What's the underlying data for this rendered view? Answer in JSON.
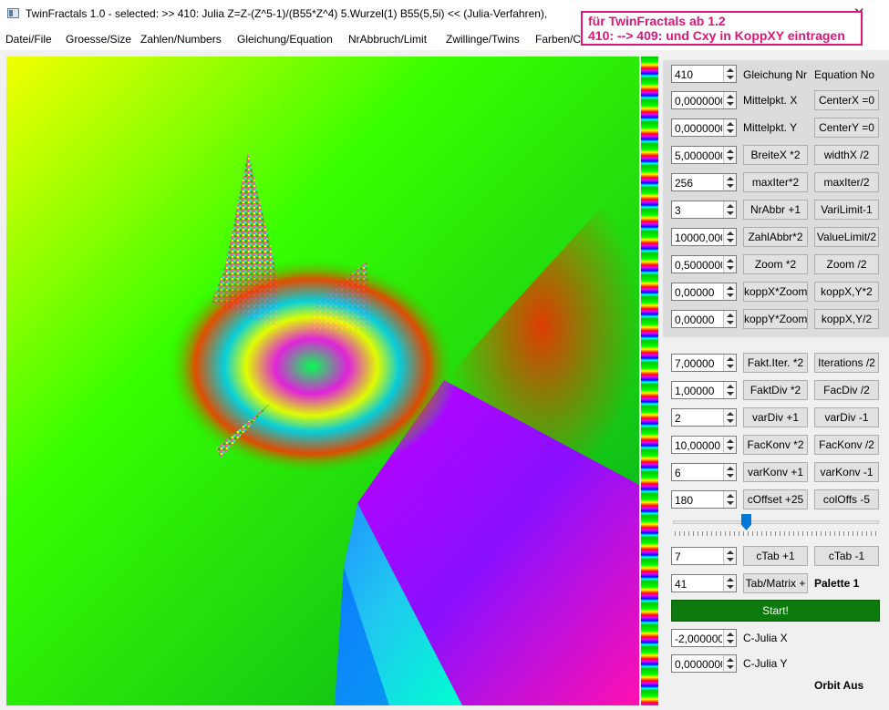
{
  "window": {
    "title": "TwinFractals 1.0 - selected: >> 410: Julia Z=Z-(Z^5-1)/(B55*Z^4) 5.Wurzel(1) B55(5,5i) << (Julia-Verfahren),",
    "close_glyph": "✕"
  },
  "menu": [
    "Datei/File",
    "Groesse/Size",
    "Zahlen/Numbers",
    "Gleichung/Equation",
    "NrAbbruch/Limit",
    "Zwillinge/Twins",
    "Farben/C"
  ],
  "note": {
    "line1": "für TwinFractals ab 1.2",
    "line2": "410: --> 409:  und Cxy in KoppXY eintragen",
    "color": "#e0157a"
  },
  "top_panel": {
    "header_left": "Gleichung Nr",
    "header_right": "Equation No",
    "rows": [
      {
        "value": "410",
        "label": "Gleichung Nr",
        "right": "Equation No",
        "kind": "header"
      },
      {
        "value": "0,0000000",
        "label": "Mittelpkt. X",
        "right": "CenterX =0",
        "kind": "label"
      },
      {
        "value": "0,0000000",
        "label": "Mittelpkt. Y",
        "right": "CenterY =0",
        "kind": "label"
      },
      {
        "value": "5,0000000",
        "left": "BreiteX *2",
        "right": "widthX /2",
        "kind": "buttons"
      },
      {
        "value": "256",
        "left": "maxIter*2",
        "right": "maxIter/2",
        "kind": "buttons"
      },
      {
        "value": "3",
        "left": "NrAbbr +1",
        "right": "VariLimit-1",
        "kind": "buttons"
      },
      {
        "value": "10000,000",
        "left": "ZahlAbbr*2",
        "right": "ValueLimit/2",
        "kind": "buttons"
      },
      {
        "value": "0,5000000",
        "left": "Zoom *2",
        "right": "Zoom /2",
        "kind": "buttons"
      },
      {
        "value": "0,00000",
        "left": "koppX*Zoom",
        "right": "koppX,Y*2",
        "kind": "buttons"
      },
      {
        "value": "0,00000",
        "left": "koppY*Zoom",
        "right": "koppX,Y/2",
        "kind": "buttons"
      }
    ]
  },
  "bottom_panel": {
    "rows": [
      {
        "value": "7,00000",
        "left": "Fakt.Iter. *2",
        "right": "Iterations /2"
      },
      {
        "value": "1,00000",
        "left": "FaktDiv *2",
        "right": "FacDiv /2"
      },
      {
        "value": "2",
        "left": "varDiv +1",
        "right": "varDiv -1"
      },
      {
        "value": "10,00000",
        "left": "FacKonv *2",
        "right": "FacKonv /2"
      },
      {
        "value": "6",
        "left": "varKonv +1",
        "right": "varKonv -1"
      },
      {
        "value": "180",
        "left": "cOffset +25",
        "right": "colOffs -5"
      }
    ],
    "slider_level": 0.35,
    "ctab": {
      "value": "7",
      "left": "cTab +1",
      "right": "cTab -1"
    },
    "tab_matrix": {
      "value": "41",
      "button": "Tab/Matrix +",
      "palette_label": "Palette 1"
    },
    "start_label": "Start!",
    "start_color": "#0c7a0c",
    "cjulia_x": {
      "value": "-2,0000000",
      "label": "C-Julia X"
    },
    "cjulia_y": {
      "value": "0,0000000",
      "label": "C-Julia Y"
    },
    "orbit_label": "Orbit Aus"
  }
}
